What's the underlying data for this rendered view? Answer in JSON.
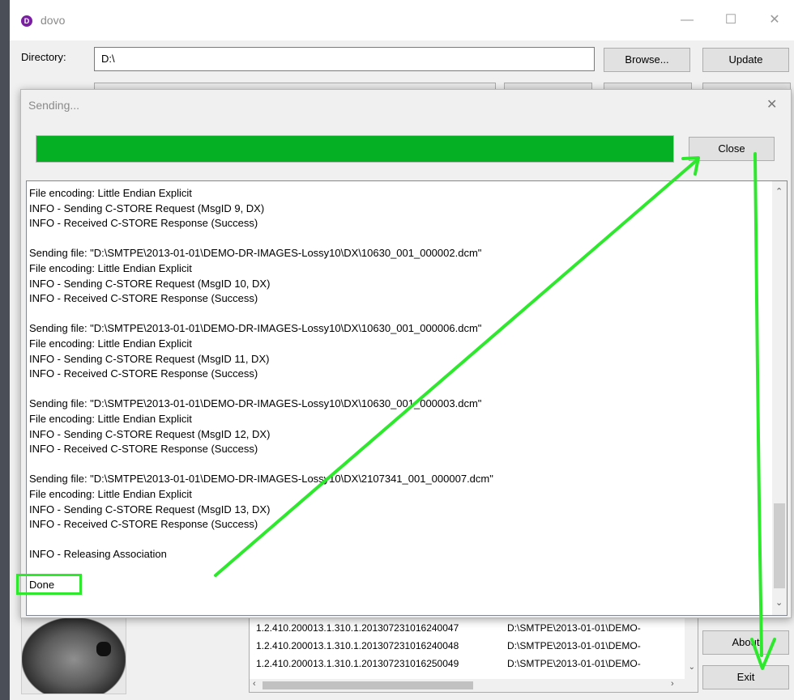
{
  "app": {
    "title": "dovo",
    "icon_letter": "D"
  },
  "window_controls": {
    "minimize": "—",
    "maximize": "☐",
    "close": "✕"
  },
  "directory": {
    "label": "Directory:",
    "value": "D:\\"
  },
  "buttons": {
    "browse": "Browse...",
    "update": "Update",
    "about": "About",
    "exit": "Exit"
  },
  "file_table": {
    "rows": [
      {
        "uid": "1.2.410.200013.1.310.1.2013072310162400​47",
        "path": "D:\\SMTPE\\2013-01-01\\DEMO-"
      },
      {
        "uid": "1.2.410.200013.1.310.1.201307231016240048",
        "path": "D:\\SMTPE\\2013-01-01\\DEMO-"
      },
      {
        "uid": "1.2.410.200013.1.310.1.201307231016250049",
        "path": "D:\\SMTPE\\2013-01-01\\DEMO-"
      }
    ]
  },
  "dialog": {
    "title": "Sending...",
    "close_x": "✕",
    "close_button": "Close",
    "progress": 1.0,
    "progress_color": "#06b025",
    "log_lines": [
      "File encoding: Little Endian Explicit",
      "INFO - Sending C-STORE Request (MsgID 9, DX)",
      "INFO - Received C-STORE Response (Success)",
      "",
      "Sending file: \"D:\\SMTPE\\2013-01-01\\DEMO-DR-IMAGES-Lossy10\\DX\\10630_001_000002.dcm\"",
      "File encoding: Little Endian Explicit",
      "INFO - Sending C-STORE Request (MsgID 10, DX)",
      "INFO - Received C-STORE Response (Success)",
      "",
      "Sending file: \"D:\\SMTPE\\2013-01-01\\DEMO-DR-IMAGES-Lossy10\\DX\\10630_001_000006.dcm\"",
      "File encoding: Little Endian Explicit",
      "INFO - Sending C-STORE Request (MsgID 11, DX)",
      "INFO - Received C-STORE Response (Success)",
      "",
      "Sending file: \"D:\\SMTPE\\2013-01-01\\DEMO-DR-IMAGES-Lossy10\\DX\\10630_001_000003.dcm\"",
      "File encoding: Little Endian Explicit",
      "INFO - Sending C-STORE Request (MsgID 12, DX)",
      "INFO - Received C-STORE Response (Success)",
      "",
      "Sending file: \"D:\\SMTPE\\2013-01-01\\DEMO-DR-IMAGES-Lossy10\\DX\\2107341_001_000007.dcm\"",
      "File encoding: Little Endian Explicit",
      "INFO - Sending C-STORE Request (MsgID 13, DX)",
      "INFO - Received C-STORE Response (Success)",
      "",
      "INFO - Releasing Association",
      "",
      "Done"
    ]
  },
  "annotation_color": "#2ee82e"
}
